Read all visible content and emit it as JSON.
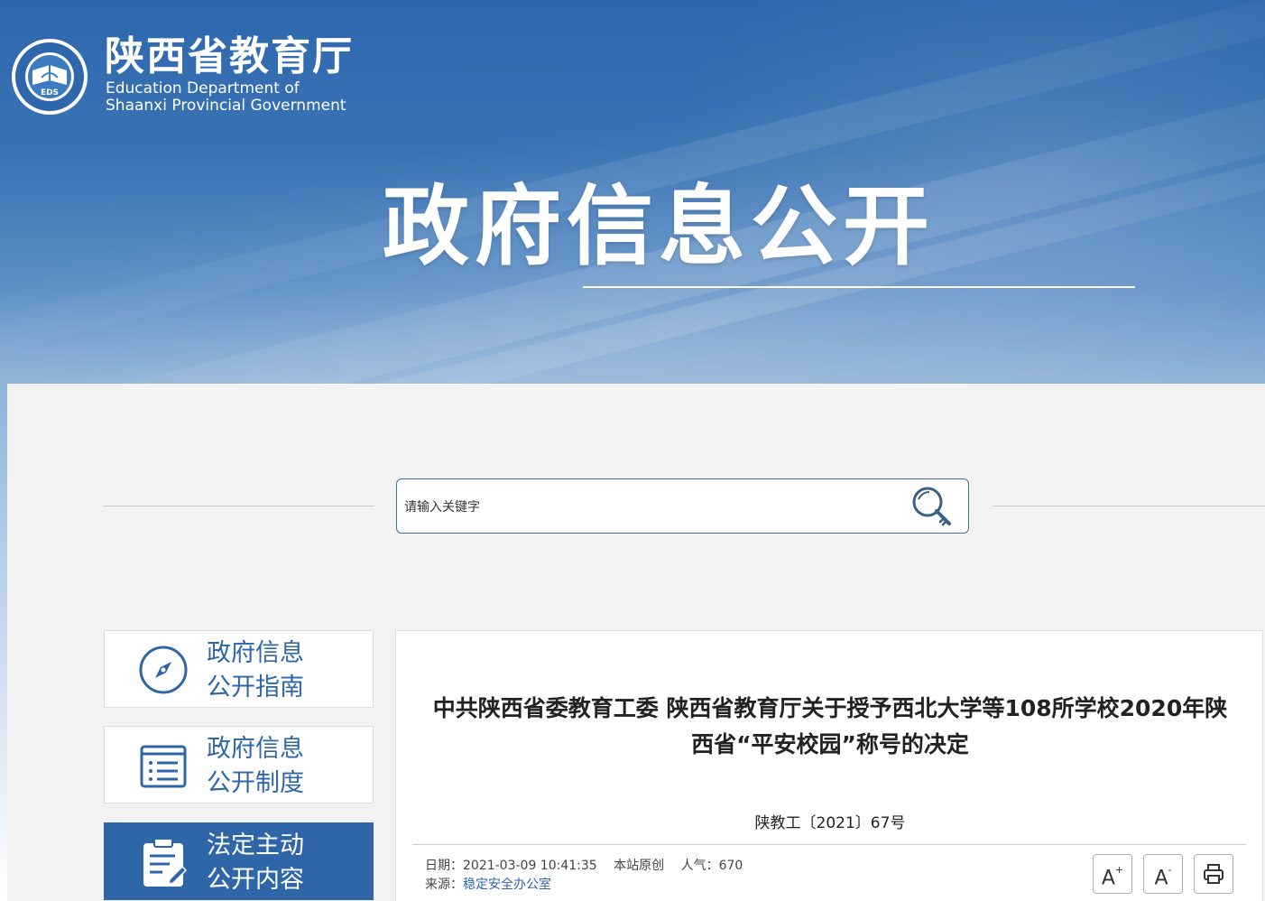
{
  "header": {
    "org_name_cn": "陕西省教育厅",
    "org_name_en_line1": "Education Department of",
    "org_name_en_line2": "Shaanxi Provincial Government",
    "emblem_text": "EDS",
    "hero_title": "政府信息公开"
  },
  "search": {
    "placeholder": "请输入关键字",
    "button_icon": "magnifier-key-icon"
  },
  "sidebar": {
    "items": [
      {
        "line1": "政府信息",
        "line2": "公开指南",
        "icon": "compass-icon",
        "active": false
      },
      {
        "line1": "政府信息",
        "line2": "公开制度",
        "icon": "document-list-icon",
        "active": false
      },
      {
        "line1": "法定主动",
        "line2": "公开内容",
        "icon": "clipboard-edit-icon",
        "active": true
      }
    ]
  },
  "article": {
    "title_line1": "中共陕西省委教育工委 陕西省教育厅关于授予西北大学等108所学校2020年陕",
    "title_line2": "西省“平安校园”称号的决定",
    "doc_number": "陕教工〔2021〕67号",
    "date_label": "日期：",
    "date_value": "2021-03-09 10:41:35",
    "origin": "本站原创",
    "views_label": "人气：",
    "views_value": "670",
    "source_label": "来源：",
    "source_value": "稳定安全办公室",
    "font_increase_label": "A",
    "font_increase_sup": "+",
    "font_decrease_label": "A",
    "font_decrease_sup": "-",
    "print_icon": "printer-icon"
  },
  "colors": {
    "brand_blue": "#2e66a8",
    "banner_top": "#2e67ac",
    "page_bg": "#f2f2f2"
  }
}
